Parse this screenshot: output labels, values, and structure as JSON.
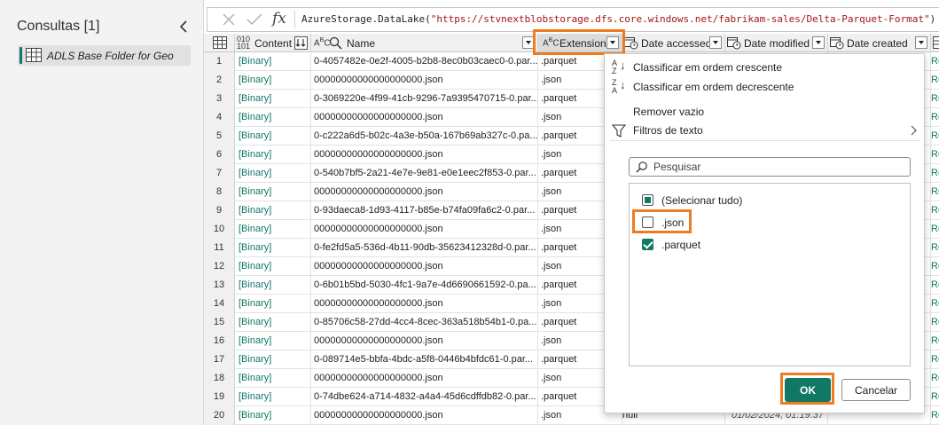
{
  "queries_pane": {
    "title": "Consultas [1]",
    "items": [
      {
        "label": "ADLS Base Folder for Geo",
        "icon": "table-icon"
      }
    ]
  },
  "formula_bar": {
    "fx": "fx",
    "prefix": "AzureStorage.DataLake(",
    "url": "\"https://stvnextblobstorage.dfs.core.windows.net/fabrikam-sales/Delta-Parquet-Format\"",
    "suffix": ")"
  },
  "columns": {
    "content": {
      "label": "Content",
      "type_icon": "binary-type-icon"
    },
    "name": {
      "label": "Name",
      "type_icon": "text-type-icon"
    },
    "extension": {
      "label": "Extension",
      "type_icon": "text-type-icon"
    },
    "date_accessed": {
      "label": "Date accessed",
      "type_icon": "datetime-type-icon"
    },
    "date_modified": {
      "label": "Date modified",
      "type_icon": "datetime-type-icon"
    },
    "date_created": {
      "label": "Date created",
      "type_icon": "datetime-type-icon"
    }
  },
  "rows": [
    {
      "idx": "1",
      "content": "[Binary]",
      "name": "0-4057482e-0e2f-4005-b2b8-8ec0b03caec0-0.par...",
      "ext": ".parquet",
      "attr": "Re"
    },
    {
      "idx": "2",
      "content": "[Binary]",
      "name": "00000000000000000000.json",
      "ext": ".json",
      "attr": "Re"
    },
    {
      "idx": "3",
      "content": "[Binary]",
      "name": "0-3069220e-4f99-41cb-9296-7a9395470715-0.par...",
      "ext": ".parquet",
      "attr": "Re"
    },
    {
      "idx": "4",
      "content": "[Binary]",
      "name": "00000000000000000000.json",
      "ext": ".json",
      "attr": "Re"
    },
    {
      "idx": "5",
      "content": "[Binary]",
      "name": "0-c222a6d5-b02c-4a3e-b50a-167b69ab327c-0.pa...",
      "ext": ".parquet",
      "attr": "Re"
    },
    {
      "idx": "6",
      "content": "[Binary]",
      "name": "00000000000000000000.json",
      "ext": ".json",
      "attr": "Re"
    },
    {
      "idx": "7",
      "content": "[Binary]",
      "name": "0-540b7bf5-2a21-4e7e-9e81-e0e1eec2f853-0.par...",
      "ext": ".parquet",
      "attr": "Re"
    },
    {
      "idx": "8",
      "content": "[Binary]",
      "name": "00000000000000000000.json",
      "ext": ".json",
      "attr": "Re"
    },
    {
      "idx": "9",
      "content": "[Binary]",
      "name": "0-93daeca8-1d93-4117-b85e-b74fa09fa6c2-0.par...",
      "ext": ".parquet",
      "attr": "Re"
    },
    {
      "idx": "10",
      "content": "[Binary]",
      "name": "00000000000000000000.json",
      "ext": ".json",
      "attr": "Re"
    },
    {
      "idx": "11",
      "content": "[Binary]",
      "name": "0-fe2fd5a5-536d-4b11-90db-35623412328d-0.par...",
      "ext": ".parquet",
      "attr": "Re"
    },
    {
      "idx": "12",
      "content": "[Binary]",
      "name": "00000000000000000000.json",
      "ext": ".json",
      "attr": "Re"
    },
    {
      "idx": "13",
      "content": "[Binary]",
      "name": "0-6b01b5bd-5030-4fc1-9a7e-4d6690661592-0.pa...",
      "ext": ".parquet",
      "attr": "Re"
    },
    {
      "idx": "14",
      "content": "[Binary]",
      "name": "00000000000000000000.json",
      "ext": ".json",
      "attr": "Re"
    },
    {
      "idx": "15",
      "content": "[Binary]",
      "name": "0-85706c58-27dd-4cc4-8cec-363a518b54b1-0.pa...",
      "ext": ".parquet",
      "attr": "Re"
    },
    {
      "idx": "16",
      "content": "[Binary]",
      "name": "00000000000000000000.json",
      "ext": ".json",
      "attr": "Re"
    },
    {
      "idx": "17",
      "content": "[Binary]",
      "name": "0-089714e5-bbfa-4bdc-a5f8-0446b4bfdc61-0.par...",
      "ext": ".parquet",
      "attr": "Re"
    },
    {
      "idx": "18",
      "content": "[Binary]",
      "name": "00000000000000000000.json",
      "ext": ".json",
      "attr": "Re"
    },
    {
      "idx": "19",
      "content": "[Binary]",
      "name": "0-74dbe624-a714-4832-a4a4-45d6cdffdb82-0.par...",
      "ext": ".parquet",
      "attr": "Re"
    },
    {
      "idx": "20",
      "content": "[Binary]",
      "name": "00000000000000000000.json",
      "ext": ".json",
      "accessed": "null",
      "modified": "01/02/2024, 01:19:37",
      "attr": "Re"
    }
  ],
  "filter_menu": {
    "sort_asc": "Classificar em ordem crescente",
    "sort_desc": "Classificar em ordem decrescente",
    "remove_empty": "Remover vazio",
    "text_filters": "Filtros de texto",
    "search_placeholder": "Pesquisar",
    "values": [
      {
        "label": "(Selecionar tudo)",
        "state": "partial"
      },
      {
        "label": ".json",
        "state": "unchecked"
      },
      {
        "label": ".parquet",
        "state": "checked"
      }
    ],
    "ok": "OK",
    "cancel": "Cancelar"
  },
  "colors": {
    "accent": "#117865",
    "highlight": "#f07c1f"
  }
}
